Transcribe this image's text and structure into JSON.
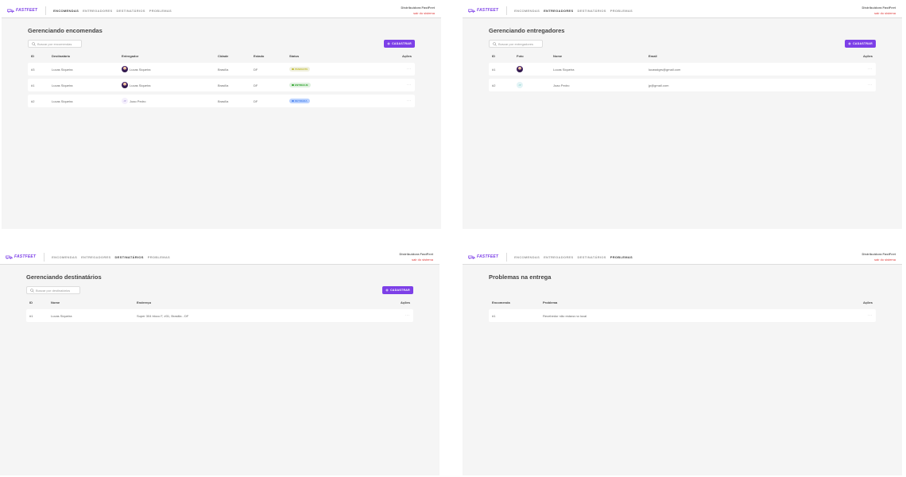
{
  "brand": {
    "logo_text": "FASTFEET",
    "org_name": "Distribuidora FastFeet",
    "logout_label": "sair do sistema",
    "accent": "#7d40e7"
  },
  "nav": [
    "ENCOMENDAS",
    "ENTREGADORES",
    "DESTINATÁRIOS",
    "PROBLEMAS"
  ],
  "panels": [
    {
      "active_nav": 0,
      "title": "Gerenciando encomendas",
      "search_placeholder": "Buscar por encomendas",
      "add_label": "CADASTRAR",
      "columns": [
        "ID",
        "Destinatário",
        "Entregador",
        "Cidade",
        "Estado",
        "Status",
        "Ações"
      ],
      "rows": [
        {
          "id": "#3",
          "recipient": "Lucas Siqueira",
          "deliveryman": "Lucas Siqueira",
          "avatar": "photo",
          "city": "Brasília",
          "state": "DF",
          "status": "PENDENTE",
          "status_color": "#c1bc35",
          "status_bg": "#f0f0df",
          "actions": "···"
        },
        {
          "id": "#1",
          "recipient": "Lucas Siqueira",
          "deliveryman": "Lucas Siqueira",
          "avatar": "photo",
          "city": "Brasília",
          "state": "DF",
          "status": "ENTREGUE",
          "status_color": "#2ca42b",
          "status_bg": "#dff0df",
          "actions": "···"
        },
        {
          "id": "#2",
          "recipient": "Lucas Siqueira",
          "deliveryman": "Joao Pedro",
          "avatar": "initials",
          "initials": "JP",
          "city": "Brasília",
          "state": "DF",
          "status": "RETIRADA",
          "status_color": "#4d85ee",
          "status_bg": "#bad2ff",
          "actions": "···"
        }
      ]
    },
    {
      "active_nav": 1,
      "title": "Gerenciando entregadores",
      "search_placeholder": "Buscar por entregadores",
      "add_label": "CADASTRAR",
      "columns": [
        "ID",
        "Foto",
        "Nome",
        "Email",
        "Ações"
      ],
      "rows": [
        {
          "id": "#1",
          "avatar": "photo",
          "name": "Lucas Siqueira",
          "email": "lucasstgrs@gmail.com",
          "actions": "···"
        },
        {
          "id": "#2",
          "avatar": "initials",
          "initials": "JP",
          "name": "Joao Pedro",
          "email": "jp@gmail.com",
          "actions": "···"
        }
      ]
    },
    {
      "active_nav": 2,
      "title": "Gerenciando destinatários",
      "search_placeholder": "Buscar por destinatários",
      "add_label": "CADASTRAR",
      "columns": [
        "ID",
        "Nome",
        "Endereço",
        "Ações"
      ],
      "rows": [
        {
          "id": "#1",
          "name": "Lucas Siqueira",
          "address": "Super 304 bloco F, #31, Brasilia - DF",
          "actions": "···"
        }
      ]
    },
    {
      "active_nav": 3,
      "title": "Problemas na entrega",
      "columns": [
        "Encomenda",
        "Problema",
        "Ações"
      ],
      "rows": [
        {
          "order": "#1",
          "problem": "Recebedor não estava no local",
          "actions": "···"
        }
      ]
    }
  ]
}
